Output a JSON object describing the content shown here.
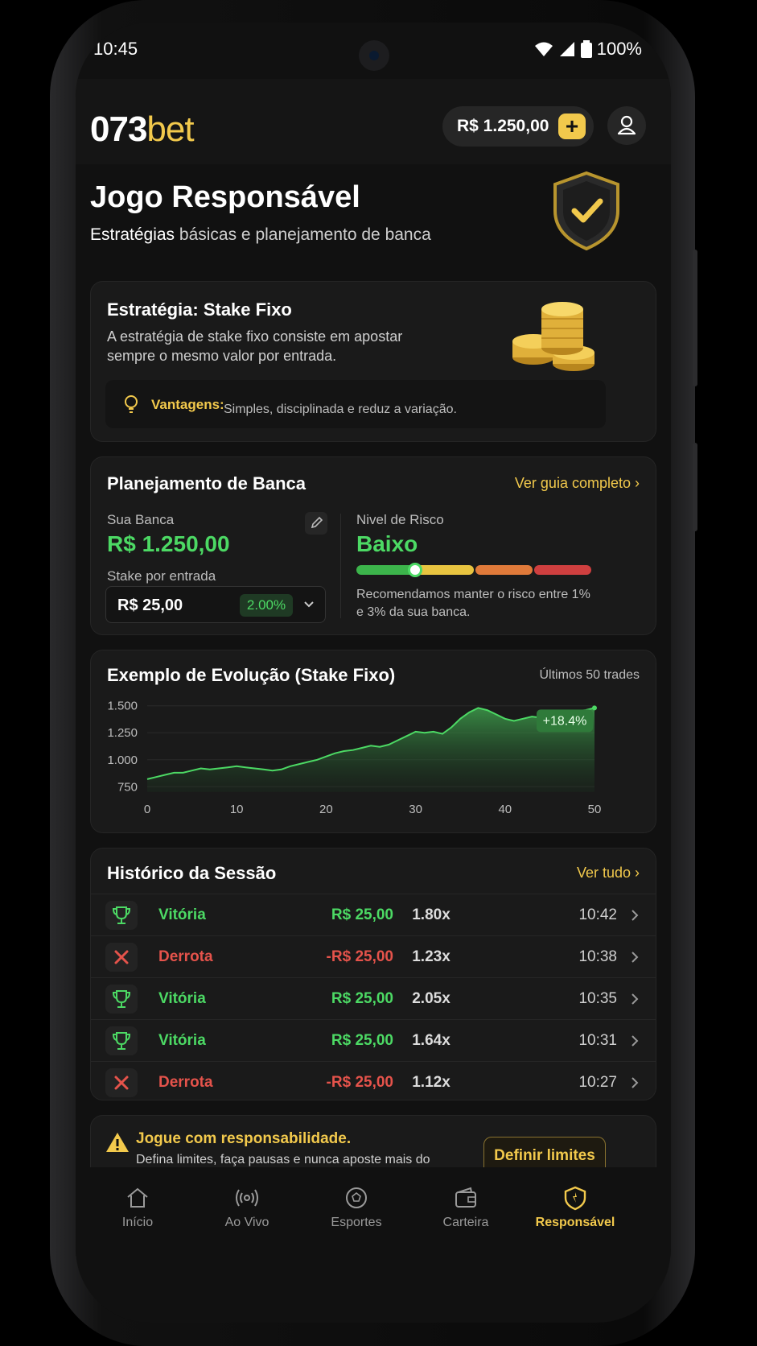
{
  "status": {
    "time": "10:45",
    "battery": "100%"
  },
  "header": {
    "logo_num": "073",
    "logo_bet": "bet",
    "balance": "R$ 1.250,00"
  },
  "hero": {
    "title": "Jogo Responsável",
    "sub_bold": "Estratégias",
    "sub_rest": " básicas e planejamento de banca"
  },
  "strategy": {
    "title": "Estratégia: Stake Fixo",
    "description": "A estratégia de stake fixo consiste em apostar sempre o mesmo valor por entrada.",
    "advantages_label": "Vantagens:",
    "advantages_text": "Simples, disciplinada e reduz a variação."
  },
  "bankroll": {
    "title": "Planejamento de Banca",
    "link": "Ver guia completo",
    "bank_label": "Sua Banca",
    "bank_value": "R$ 1.250,00",
    "stake_label": "Stake por entrada",
    "stake_value": "R$ 25,00",
    "stake_pct": "2.00%",
    "risk_label": "Nivel de Risco",
    "risk_value": "Baixo",
    "risk_level": 0.25,
    "risk_note": "Recomendamos manter o risco entre 1% e 3% da sua banca."
  },
  "evolution": {
    "title": "Exemplo de Evolução (Stake Fixo)",
    "note": "Últimos 50 trades",
    "badge": "+18.4%"
  },
  "chart_data": {
    "type": "area",
    "title": "Exemplo de Evolução (Stake Fixo)",
    "x_ticks": [
      "0",
      "10",
      "20",
      "30",
      "40",
      "50"
    ],
    "y_ticks": [
      "1.500",
      "1.250",
      "1.000",
      "750"
    ],
    "ylim": [
      700,
      1550
    ],
    "xlim": [
      0,
      50
    ],
    "grid": true,
    "x": [
      0,
      1,
      2,
      3,
      4,
      5,
      6,
      7,
      8,
      9,
      10,
      11,
      12,
      13,
      14,
      15,
      16,
      17,
      18,
      19,
      20,
      21,
      22,
      23,
      24,
      25,
      26,
      27,
      28,
      29,
      30,
      31,
      32,
      33,
      34,
      35,
      36,
      37,
      38,
      39,
      40,
      41,
      42,
      43,
      44,
      45,
      46,
      47,
      48,
      49,
      50
    ],
    "values": [
      820,
      840,
      860,
      880,
      880,
      900,
      920,
      910,
      920,
      930,
      940,
      930,
      920,
      910,
      900,
      910,
      940,
      960,
      980,
      1000,
      1030,
      1060,
      1080,
      1090,
      1110,
      1130,
      1120,
      1140,
      1180,
      1220,
      1260,
      1250,
      1260,
      1240,
      1300,
      1380,
      1440,
      1480,
      1460,
      1420,
      1380,
      1360,
      1380,
      1400,
      1390,
      1410,
      1440,
      1430,
      1450,
      1460,
      1480
    ],
    "series_color": "#4cd964"
  },
  "history": {
    "title": "Histórico da Sessão",
    "link": "Ver tudo",
    "rows": [
      {
        "result": "Vitória",
        "amount": "R$ 25,00",
        "mult": "1.80x",
        "time": "10:42",
        "win": true
      },
      {
        "result": "Derrota",
        "amount": "-R$ 25,00",
        "mult": "1.23x",
        "time": "10:38",
        "win": false
      },
      {
        "result": "Vitória",
        "amount": "R$ 25,00",
        "mult": "2.05x",
        "time": "10:35",
        "win": true
      },
      {
        "result": "Vitória",
        "amount": "R$ 25,00",
        "mult": "1.64x",
        "time": "10:31",
        "win": true
      },
      {
        "result": "Derrota",
        "amount": "-R$ 25,00",
        "mult": "1.12x",
        "time": "10:27",
        "win": false
      }
    ]
  },
  "warning": {
    "title": "Jogue com responsabilidade.",
    "text": "Defina limites, faça pausas e nunca aposte mais do que pode perder.",
    "button": "Definir limites"
  },
  "nav": {
    "items": [
      {
        "label": "Início",
        "icon": "home-icon"
      },
      {
        "label": "Ao Vivo",
        "icon": "live-icon"
      },
      {
        "label": "Esportes",
        "icon": "sports-ball-icon"
      },
      {
        "label": "Carteira",
        "icon": "wallet-icon"
      },
      {
        "label": "Responsável",
        "icon": "shield-icon",
        "active": true
      }
    ]
  },
  "colors": {
    "accent": "#f2c94c",
    "win": "#4cd964",
    "loss": "#e5534b",
    "background": "#111111"
  }
}
